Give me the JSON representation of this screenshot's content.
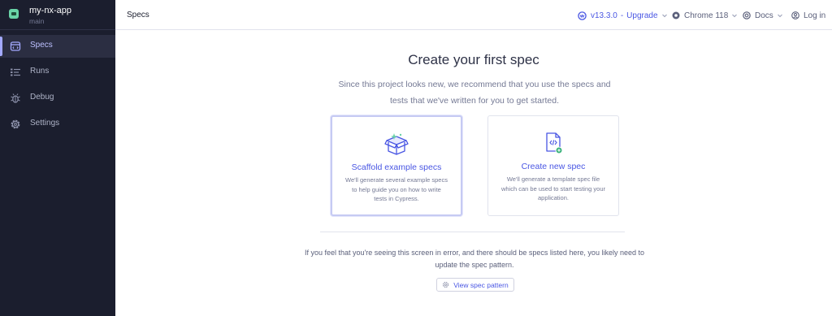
{
  "project": {
    "name": "my-nx-app",
    "branch": "main"
  },
  "sidebar": {
    "items": [
      {
        "label": "Specs",
        "icon": "specs-icon",
        "active": true
      },
      {
        "label": "Runs",
        "icon": "runs-icon",
        "active": false
      },
      {
        "label": "Debug",
        "icon": "debug-icon",
        "active": false
      },
      {
        "label": "Settings",
        "icon": "settings-icon",
        "active": false
      }
    ]
  },
  "header": {
    "title": "Specs",
    "version": "v13.3.0",
    "upgrade": "Upgrade",
    "browser": "Chrome 118",
    "docs": "Docs",
    "login": "Log in"
  },
  "main": {
    "title": "Create your first spec",
    "description": "Since this project looks new, we recommend that you use the specs and tests that we've written for you to get started.",
    "cards": [
      {
        "title": "Scaffold example specs",
        "description": "We'll generate several example specs to help guide you on how to write tests in Cypress.",
        "icon": "box-icon"
      },
      {
        "title": "Create new spec",
        "description": "We'll generate a template spec file which can be used to start testing your application.",
        "icon": "new-file-icon"
      }
    ],
    "error_text": "If you feel that you're seeing this screen in error, and there should be specs listed here, you likely need to update the spec pattern.",
    "view_pattern_label": "View spec pattern"
  },
  "colors": {
    "sidebar_bg": "#1b1e2e",
    "accent": "#4956e3",
    "active_nav": "#a3a9ff",
    "project_logo": "#69d3a7"
  }
}
